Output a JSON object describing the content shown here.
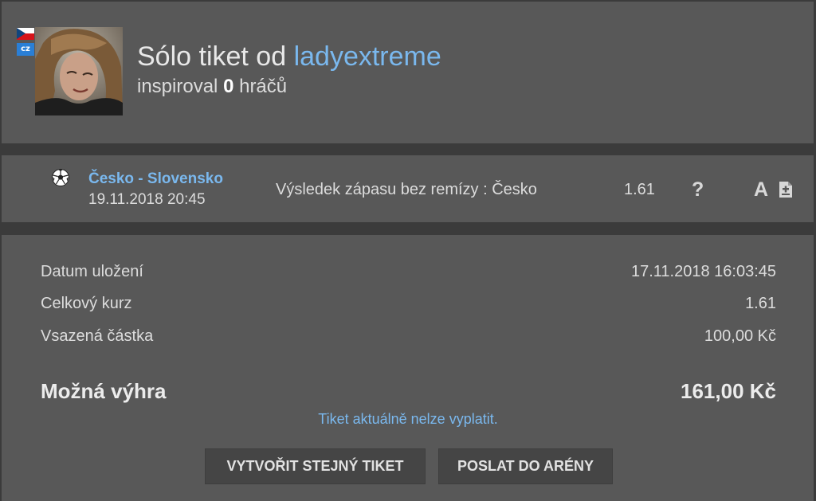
{
  "header": {
    "country_badge": "cz",
    "title_prefix": "Sólo tiket od",
    "username": "ladyextreme",
    "inspired_prefix": "inspiroval",
    "inspired_count": "0",
    "inspired_suffix": "hráčů"
  },
  "match": {
    "name": "Česko - Slovensko",
    "datetime": "19.11.2018 20:45",
    "bet": "Výsledek zápasu bez remízy : Česko",
    "odd": "1.61",
    "status_icon": "?",
    "analysis_icon": "A"
  },
  "summary": {
    "rows": [
      {
        "label": "Datum uložení",
        "value": "17.11.2018 16:03:45"
      },
      {
        "label": "Celkový kurz",
        "value": "1.61"
      },
      {
        "label": "Vsazená částka",
        "value": "100,00 Kč"
      }
    ],
    "win_label": "Možná výhra",
    "win_value": "161,00 Kč",
    "note": "Tiket aktuálně nelze vyplatit."
  },
  "buttons": {
    "same_ticket": "Vytvořit stejný tiket",
    "send_arena": "Poslat do arény"
  },
  "colors": {
    "background": "#3b3b3b",
    "panel": "#585858",
    "link": "#7ab8ee",
    "button": "#454545"
  },
  "icons": [
    "czech-flag-icon",
    "soccer-ball-icon",
    "question-icon",
    "analysis-a-icon",
    "document-icon"
  ]
}
